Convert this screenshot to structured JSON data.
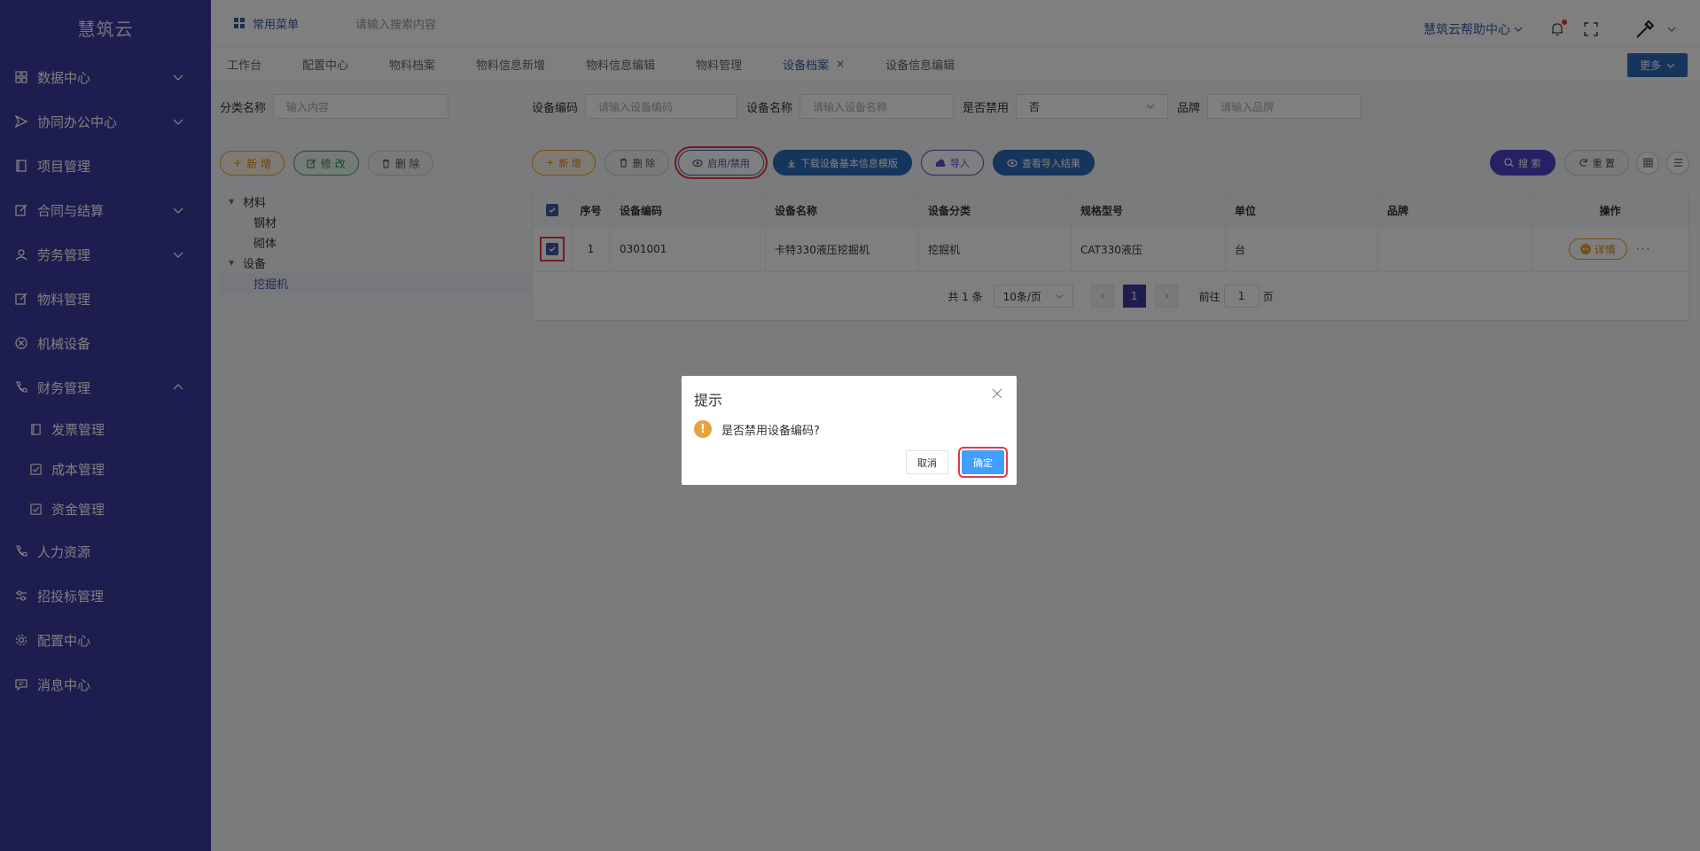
{
  "app": {
    "logo": "慧筑云"
  },
  "sidebar": {
    "items": [
      {
        "label": "数据中心",
        "icon": "grid-icon",
        "expandable": true
      },
      {
        "label": "协同办公中心",
        "icon": "send-icon",
        "expandable": true
      },
      {
        "label": "项目管理",
        "icon": "book-icon",
        "expandable": false
      },
      {
        "label": "合同与结算",
        "icon": "edit-icon",
        "expandable": true
      },
      {
        "label": "劳务管理",
        "icon": "user-icon",
        "expandable": true
      },
      {
        "label": "物料管理",
        "icon": "edit-icon",
        "expandable": false
      },
      {
        "label": "机械设备",
        "icon": "circle-x-icon",
        "expandable": false
      },
      {
        "label": "财务管理",
        "icon": "phone-icon",
        "expandable": true
      }
    ],
    "finance_sub": [
      {
        "label": "发票管理",
        "icon": "book-icon"
      },
      {
        "label": "成本管理",
        "icon": "checkbox-icon"
      },
      {
        "label": "资金管理",
        "icon": "checkbox-icon"
      }
    ],
    "bottom_items": [
      {
        "label": "人力资源",
        "icon": "phone-icon"
      },
      {
        "label": "招投标管理",
        "icon": "sliders-icon"
      },
      {
        "label": "配置中心",
        "icon": "gear-icon"
      },
      {
        "label": "消息中心",
        "icon": "message-icon"
      }
    ]
  },
  "topbar": {
    "menu_label": "常用菜单",
    "search_placeholder": "请输入搜索内容",
    "help_label": "慧筑云帮助中心"
  },
  "tabs": [
    {
      "label": "工作台"
    },
    {
      "label": "配置中心"
    },
    {
      "label": "物料档案"
    },
    {
      "label": "物料信息新增"
    },
    {
      "label": "物料信息编辑"
    },
    {
      "label": "物料管理"
    },
    {
      "label": "设备档案",
      "active": true,
      "close": "×"
    },
    {
      "label": "设备信息编辑"
    }
  ],
  "more_label": "更多",
  "left_panel": {
    "category_label": "分类名称",
    "category_placeholder": "输入内容",
    "add": "新 增",
    "edit": "修 改",
    "delete": "删 除",
    "tree": [
      {
        "label": "材料",
        "level": 1
      },
      {
        "label": "钢材",
        "level": 2
      },
      {
        "label": "砌体",
        "level": 2
      },
      {
        "label": "设备",
        "level": 1
      },
      {
        "label": "挖掘机",
        "level": 2,
        "selected": true
      }
    ]
  },
  "filters": {
    "code_label": "设备编码",
    "code_placeholder": "请输入设备编码",
    "name_label": "设备名称",
    "name_placeholder": "请输入设备名称",
    "disabled_label": "是否禁用",
    "disabled_value": "否",
    "brand_label": "品牌",
    "brand_placeholder": "请输入品牌"
  },
  "actions": {
    "add": "新 增",
    "delete": "删 除",
    "toggle": "启用/禁用",
    "download": "下载设备基本信息模版",
    "import": "导入",
    "view_import": "查看导入结果",
    "search": "搜 索",
    "reset": "重 置"
  },
  "table": {
    "headers": [
      "序号",
      "设备编码",
      "设备名称",
      "设备分类",
      "规格型号",
      "单位",
      "品牌",
      "操作"
    ],
    "rows": [
      {
        "index": "1",
        "code": "0301001",
        "name": "卡特330液压挖掘机",
        "category": "挖掘机",
        "model": "CAT330液压",
        "unit": "台",
        "brand": "",
        "detail": "详情",
        "more": "···"
      }
    ]
  },
  "pager": {
    "total": "共 1 条",
    "size": "10条/页",
    "current": "1",
    "goto_prefix": "前往",
    "goto_value": "1",
    "goto_suffix": "页"
  },
  "dialog": {
    "title": "提示",
    "icon": "!",
    "message": "是否禁用设备编码?",
    "cancel": "取消",
    "confirm": "确定"
  },
  "colors": {
    "sidebar_bg": "#3b3a9e",
    "accent": "#3e5aa7",
    "primary_button": "#409eff",
    "highlight": "#e53945"
  }
}
